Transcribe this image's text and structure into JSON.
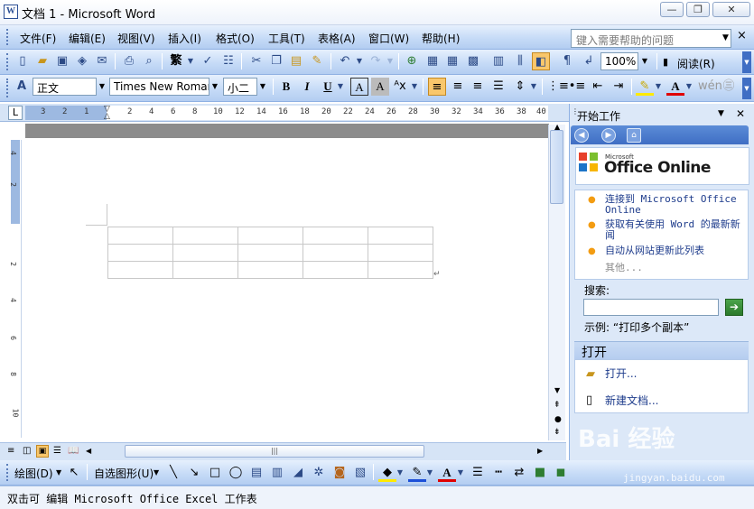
{
  "window": {
    "title": "文档 1 - Microsoft Word",
    "app_icon": "W",
    "minimize": "0",
    "restore": "1",
    "close": "r"
  },
  "menubar": {
    "items": [
      "文件(F)",
      "编辑(E)",
      "视图(V)",
      "插入(I)",
      "格式(O)",
      "工具(T)",
      "表格(A)",
      "窗口(W)",
      "帮助(H)"
    ],
    "help_placeholder": "键入需要帮助的问题",
    "close_glyph": "×"
  },
  "standard_toolbar": {
    "zoom": "100%",
    "read_label": "阅读(R)"
  },
  "formatting_toolbar": {
    "style": "正文",
    "font": "Times New Roman",
    "size": "小二",
    "bold": "B",
    "italic": "I",
    "underline": "U"
  },
  "ruler": {
    "marks": [
      "3",
      "2",
      "1",
      "2",
      "4",
      "6",
      "8",
      "10",
      "12",
      "14",
      "16",
      "18",
      "20",
      "22",
      "24",
      "26",
      "28",
      "30",
      "32",
      "34",
      "36",
      "38",
      "40"
    ],
    "tab_selector": "L"
  },
  "vertical_ruler": {
    "marks": [
      "4",
      "2",
      "2",
      "4",
      "6",
      "8",
      "10"
    ]
  },
  "document": {
    "table_rows": 3,
    "table_cols": 5,
    "paragraph_mark": "↵"
  },
  "task_pane": {
    "title": "开始工作",
    "office_online": "Office Online",
    "office_online_small": "Microsoft",
    "links": [
      "连接到 Microsoft Office Online",
      "获取有关使用 Word 的最新新闻",
      "自动从网站更新此列表"
    ],
    "more": "其他...",
    "search_label": "搜索:",
    "example": "示例: “打印多个副本”",
    "open_section_title": "打开",
    "open_items": [
      "打开...",
      "新建文档..."
    ]
  },
  "drawing_toolbar": {
    "draw_label": "绘图(D)",
    "autoshapes_label": "自选图形(U)"
  },
  "statusbar": {
    "text": "双击可 编辑 Microsoft Office Excel 工作表"
  },
  "watermark": {
    "brand": "Bai 经验",
    "url": "jingyan.baidu.com"
  },
  "colors": {
    "toolbar_top": "#e6f0fd",
    "toolbar_bottom": "#b3cdf1",
    "taskpane_bg": "#dce8f8",
    "link": "#1e3c8c",
    "bullet": "#f39c12"
  }
}
